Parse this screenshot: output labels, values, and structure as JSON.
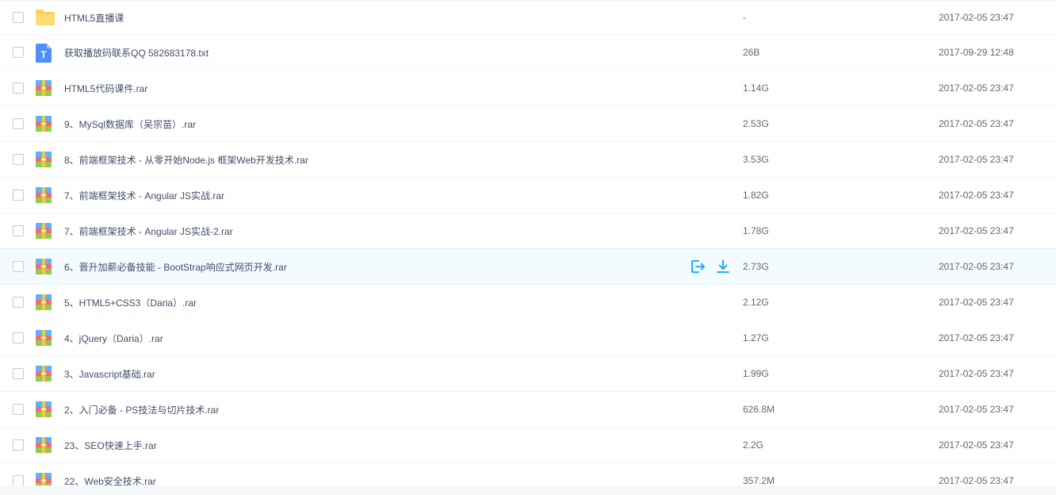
{
  "colors": {
    "accent": "#06a7ff",
    "folder": "#ffd15c",
    "txt_icon": "#4f8ef7"
  },
  "files": [
    {
      "name": "HTML5直播课",
      "size": "-",
      "date": "2017-02-05 23:47",
      "icon": "folder-icon"
    },
    {
      "name": "获取播放码联系QQ 582683178.txt",
      "size": "26B",
      "date": "2017-09-29 12:48",
      "icon": "text-file-icon"
    },
    {
      "name": "HTML5代码课件.rar",
      "size": "1.14G",
      "date": "2017-02-05 23:47",
      "icon": "archive-icon"
    },
    {
      "name": "9、MySql数据库（吴宗苗）.rar",
      "size": "2.53G",
      "date": "2017-02-05 23:47",
      "icon": "archive-icon"
    },
    {
      "name": "8、前端框架技术 - 从零开始Node.js 框架Web开发技术.rar",
      "size": "3.53G",
      "date": "2017-02-05 23:47",
      "icon": "archive-icon"
    },
    {
      "name": "7、前端框架技术 - Angular JS实战.rar",
      "size": "1.82G",
      "date": "2017-02-05 23:47",
      "icon": "archive-icon"
    },
    {
      "name": "7、前端框架技术 - Angular JS实战-2.rar",
      "size": "1.78G",
      "date": "2017-02-05 23:47",
      "icon": "archive-icon"
    },
    {
      "name": "6、晋升加薪必备技能 - BootStrap响应式网页开发.rar",
      "size": "2.73G",
      "date": "2017-02-05 23:47",
      "icon": "archive-icon",
      "hovered": true
    },
    {
      "name": "5、HTML5+CSS3（Daria）.rar",
      "size": "2.12G",
      "date": "2017-02-05 23:47",
      "icon": "archive-icon"
    },
    {
      "name": "4、jQuery（Daria）.rar",
      "size": "1.27G",
      "date": "2017-02-05 23:47",
      "icon": "archive-icon"
    },
    {
      "name": "3、Javascript基础.rar",
      "size": "1.99G",
      "date": "2017-02-05 23:47",
      "icon": "archive-icon"
    },
    {
      "name": "2、入门必备 - PS技法与切片技术.rar",
      "size": "626.8M",
      "date": "2017-02-05 23:47",
      "icon": "archive-icon"
    },
    {
      "name": "23、SEO快速上手.rar",
      "size": "2.2G",
      "date": "2017-02-05 23:47",
      "icon": "archive-icon"
    },
    {
      "name": "22、Web安全技术.rar",
      "size": "357.2M",
      "date": "2017-02-05 23:47",
      "icon": "archive-icon"
    }
  ],
  "row_actions": {
    "share_icon": "share-icon",
    "download_icon": "download-icon"
  }
}
